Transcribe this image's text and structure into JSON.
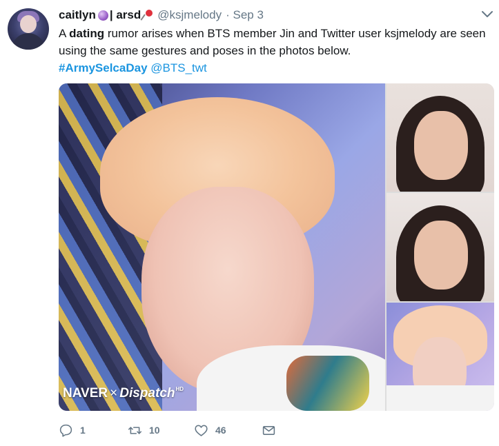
{
  "tweet": {
    "author_name": "caitlyn",
    "author_separator": "| arsd",
    "handle": "@ksjmelody",
    "date": "· Sep 3",
    "text_prefix": "A",
    "text_bold": "dating",
    "text_rest": "rumor arises when BTS member Jin and Twitter user ksjmelody are seen using the same gestures and poses in the photos below.",
    "hashtag": "#ArmySelcaDay",
    "mention": "@BTS_twt"
  },
  "media": {
    "watermark_naver": "NAVER",
    "watermark_x": "×",
    "watermark_dispatch": "Dispatch",
    "watermark_hd": "HD"
  },
  "actions": {
    "reply_count": "1",
    "retweet_count": "10",
    "like_count": "46"
  },
  "icons": {
    "avatar": "profile-avatar",
    "orb": "crystal-ball-emoji",
    "pin": "pushpin-emoji",
    "menu": "chevron-down-icon",
    "reply": "reply-icon",
    "retweet": "retweet-icon",
    "like": "heart-icon",
    "dm": "envelope-icon"
  },
  "colors": {
    "link": "#1b95e0",
    "text": "#14171a",
    "secondary": "#657786"
  }
}
